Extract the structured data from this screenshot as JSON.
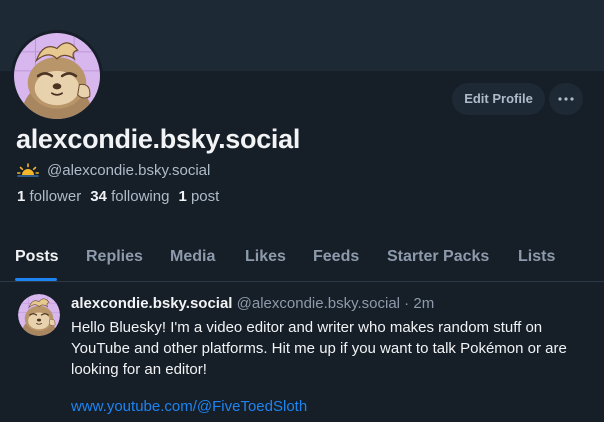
{
  "profile": {
    "display_name": "alexcondie.bsky.social",
    "handle": "@alexcondie.bsky.social",
    "handle_icon": "sunrise-icon",
    "avatar_icon": "sloth-avatar",
    "edit_button": "Edit Profile",
    "more_icon": "more-horizontal-icon"
  },
  "stats": {
    "followers_count": "1",
    "followers_label": "follower",
    "following_count": "34",
    "following_label": "following",
    "posts_count": "1",
    "posts_label": "post"
  },
  "tabs": [
    {
      "label": "Posts",
      "active": true
    },
    {
      "label": "Replies"
    },
    {
      "label": "Media"
    },
    {
      "label": "Likes"
    },
    {
      "label": "Feeds"
    },
    {
      "label": "Starter Packs"
    },
    {
      "label": "Lists"
    }
  ],
  "post": {
    "author": "alexcondie.bsky.social",
    "handle_time": "@alexcondie.bsky.social · 2m",
    "text": "Hello Bluesky! I'm a video editor and writer who makes random stuff on YouTube and other platforms. Hit me up if you want to talk Pokémon or are looking for an editor!",
    "link": "www.youtube.com/@FiveToedSloth"
  },
  "colors": {
    "background": "#161e27",
    "banner": "#1e2936",
    "accent": "#1d84f2",
    "text_primary": "#f1f3f5",
    "text_secondary": "#aebbc9",
    "avatar_background": "#d8b7ef"
  }
}
